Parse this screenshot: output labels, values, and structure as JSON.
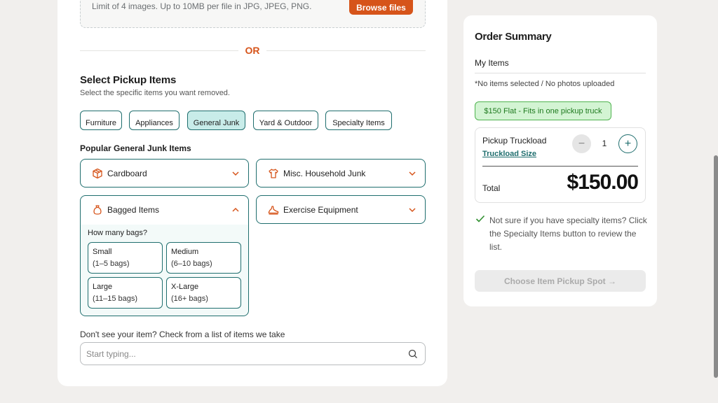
{
  "upload": {
    "note": "Limit of 4 images. Up to 10MB per file in JPG, JPEG, PNG.",
    "browse_label": "Browse files"
  },
  "divider": {
    "or_text": "OR"
  },
  "pickup": {
    "title": "Select Pickup Items",
    "subtitle": "Select the specific items you want removed.",
    "categories": [
      "Furniture",
      "Appliances",
      "General Junk",
      "Yard & Outdoor",
      "Specialty Items"
    ],
    "active_category": "General Junk",
    "popular_title": "Popular General Junk Items",
    "items": [
      {
        "label": "Cardboard",
        "icon": "box-icon"
      },
      {
        "label": "Misc. Household Junk",
        "icon": "shirt-icon"
      },
      {
        "label": "Bagged Items",
        "icon": "bag-icon"
      },
      {
        "label": "Exercise Equipment",
        "icon": "shoe-icon"
      }
    ],
    "bags": {
      "question": "How many bags?",
      "options": [
        {
          "name": "Small",
          "range": "(1–5 bags)"
        },
        {
          "name": "Medium",
          "range": "(6–10 bags)"
        },
        {
          "name": "Large",
          "range": "(11–15 bags)"
        },
        {
          "name": "X-Large",
          "range": "(16+ bags)"
        }
      ]
    },
    "search_prompt": "Don't see your item? Check from a list of items we take",
    "search_placeholder": "Start typing..."
  },
  "summary": {
    "title": "Order Summary",
    "my_items": "My Items",
    "no_items": "*No items selected / No photos uploaded",
    "flat_badge": "$150 Flat - Fits in one pickup truck",
    "truck_label": "Pickup Truckload",
    "truck_link": "Truckload Size",
    "qty": "1",
    "total_label": "Total",
    "total_value": "$150.00",
    "note": "Not sure if you have specialty items? Click the Specialty Items button to review the list.",
    "choose_label": "Choose Item Pickup Spot →"
  },
  "colors": {
    "accent": "#d6541a",
    "teal": "#1f6e6e",
    "active_chip": "#c8ece9",
    "badge_bg": "#d3f4d3"
  }
}
